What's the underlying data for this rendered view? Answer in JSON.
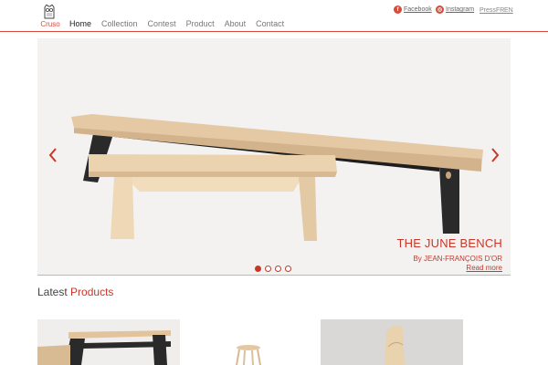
{
  "header": {
    "logo_text": "Cruso",
    "nav": [
      {
        "label": "Home",
        "active": true
      },
      {
        "label": "Collection",
        "active": false
      },
      {
        "label": "Contest",
        "active": false
      },
      {
        "label": "Product",
        "active": false
      },
      {
        "label": "About",
        "active": false
      },
      {
        "label": "Contact",
        "active": false
      }
    ],
    "social": {
      "facebook_label": "Facebook",
      "instagram_label": "Instagram"
    },
    "press_label": "Press",
    "lang_fr": "FR",
    "lang_en": "EN"
  },
  "slider": {
    "title": "THE JUNE BENCH",
    "byline": "By JEAN-FRANÇOIS D'OR",
    "read_more": "Read more",
    "slide_count": 4,
    "active_slide": 1
  },
  "latest": {
    "word1": "Latest",
    "word2": "Products"
  },
  "colors": {
    "accent": "#c8372a",
    "header_rule": "#d94a3a"
  }
}
